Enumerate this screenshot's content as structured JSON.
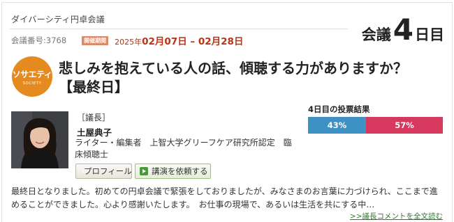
{
  "header": {
    "series_title": "ダイバーシティ円卓会議",
    "meeting_number": "会議番号:3768",
    "period_badge": "開催期間",
    "period_year": "2025年",
    "period_start": "02月07日",
    "period_sep": " – ",
    "period_end": "02月28日"
  },
  "day_counter": {
    "prefix": "会議",
    "number": "4",
    "suffix": "日目"
  },
  "logo": {
    "main": "ソサエティ",
    "sub": "SOCIETY"
  },
  "title": "悲しみを抱えている人の話、傾聴する力がありますか？【最終日】",
  "chair": {
    "role": "［議長］",
    "name": "土屋典子",
    "profile": "ライター・編集者　上智大学グリーフケア研究所認定　臨床傾聴士",
    "profile_button": "プロフィール",
    "request_button": "講演を依頼する"
  },
  "vote": {
    "title": "4日目の投票結果",
    "options": [
      {
        "label": "43%",
        "value": 43,
        "color": "#3e91c4"
      },
      {
        "label": "57%",
        "value": 57,
        "color": "#d6385e"
      }
    ]
  },
  "comment": {
    "text": "最終日となりました。初めての円卓会議で緊張をしておりましたが、みなさまのお言葉に力づけられ、ここまで進めることができました。心より感謝いたします。　お仕事の現場で、あるいは生活を共にする中…",
    "more_link": ">>議長コメントを全文読む"
  }
}
